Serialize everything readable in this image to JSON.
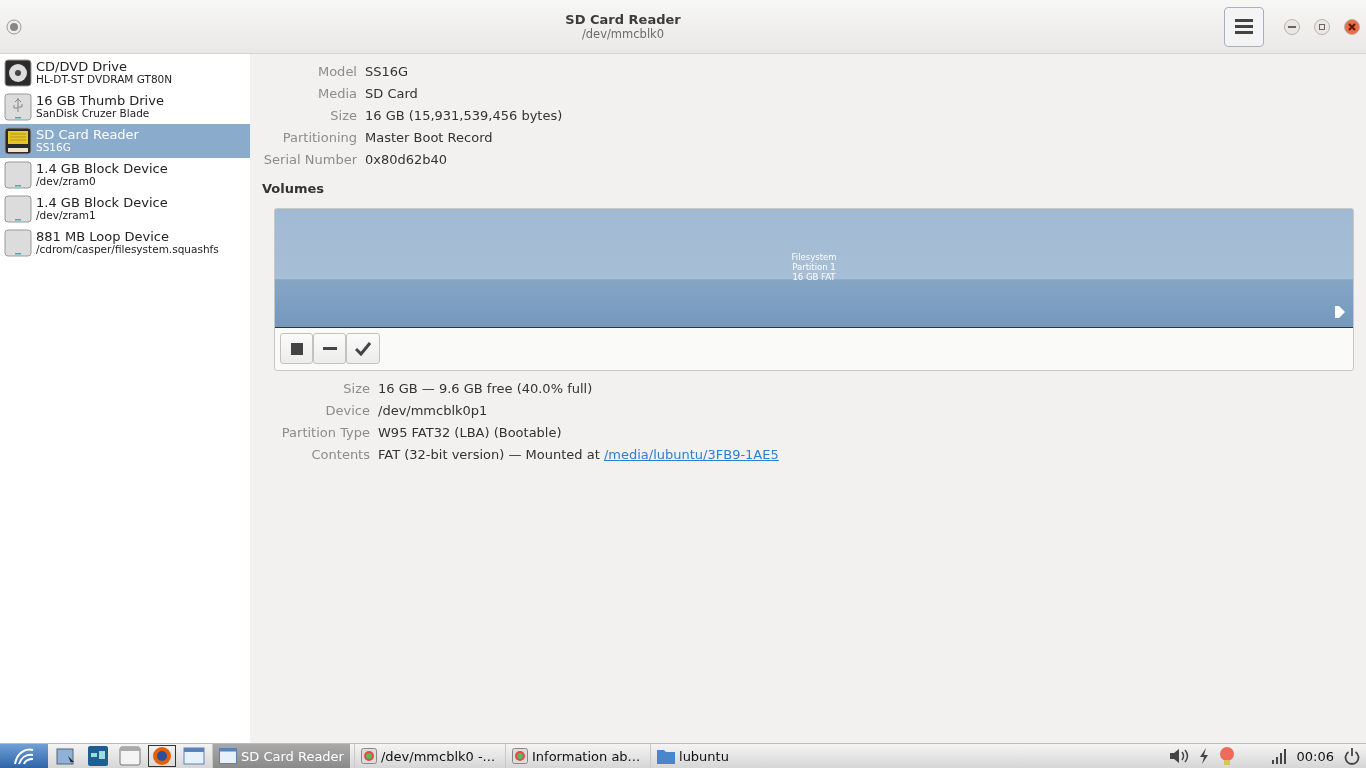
{
  "window": {
    "title": "SD Card Reader",
    "subtitle": "/dev/mmcblk0"
  },
  "devices": [
    {
      "name": "CD/DVD Drive",
      "detail": "HL-DT-ST DVDRAM GT80N",
      "kind": "optical",
      "selected": false
    },
    {
      "name": "16 GB Thumb Drive",
      "detail": "SanDisk Cruzer Blade",
      "kind": "usb",
      "selected": false
    },
    {
      "name": "SD Card Reader",
      "detail": "SS16G",
      "kind": "sdcard",
      "selected": true
    },
    {
      "name": "1.4 GB Block Device",
      "detail": "/dev/zram0",
      "kind": "disk",
      "selected": false
    },
    {
      "name": "1.4 GB Block Device",
      "detail": "/dev/zram1",
      "kind": "disk",
      "selected": false
    },
    {
      "name": "881 MB Loop Device",
      "detail": "/cdrom/casper/filesystem.squashfs",
      "kind": "disk",
      "selected": false
    }
  ],
  "drive_info": [
    {
      "label": "Model",
      "value": "SS16G"
    },
    {
      "label": "Media",
      "value": "SD Card"
    },
    {
      "label": "Size",
      "value": "16 GB (15,931,539,456 bytes)"
    },
    {
      "label": "Partitioning",
      "value": "Master Boot Record"
    },
    {
      "label": "Serial Number",
      "value": "0x80d62b40"
    }
  ],
  "volumes": {
    "heading": "Volumes",
    "partition": {
      "lines": [
        "Filesystem",
        "Partition 1",
        "16 GB FAT"
      ],
      "mounted": true,
      "selected": true
    },
    "tools": [
      {
        "kind": "stop"
      },
      {
        "kind": "minus"
      },
      {
        "kind": "check"
      }
    ],
    "info": [
      {
        "label": "Size",
        "value": "16 GB — 9.6 GB free (40.0% full)"
      },
      {
        "label": "Device",
        "value": "/dev/mmcblk0p1"
      },
      {
        "label": "Partition Type",
        "value": "W95 FAT32 (LBA) (Bootable)"
      },
      {
        "label": "Contents",
        "value": "FAT (32-bit version) — Mounted at ",
        "link": "/media/lubuntu/3FB9-1AE5"
      }
    ]
  },
  "taskbar": {
    "launchers": [
      {
        "kind": "files"
      },
      {
        "kind": "map"
      },
      {
        "kind": "window"
      },
      {
        "kind": "firefox"
      },
      {
        "kind": "desktop"
      }
    ],
    "tasks": [
      {
        "label": "SD Card Reader",
        "kind": "window",
        "selected": true
      },
      {
        "label": "/dev/mmcblk0 -...",
        "kind": "disk",
        "selected": false
      },
      {
        "label": "Information ab...",
        "kind": "disk",
        "selected": false
      },
      {
        "label": "lubuntu",
        "kind": "folder",
        "selected": false
      }
    ],
    "clock": "00:06"
  }
}
